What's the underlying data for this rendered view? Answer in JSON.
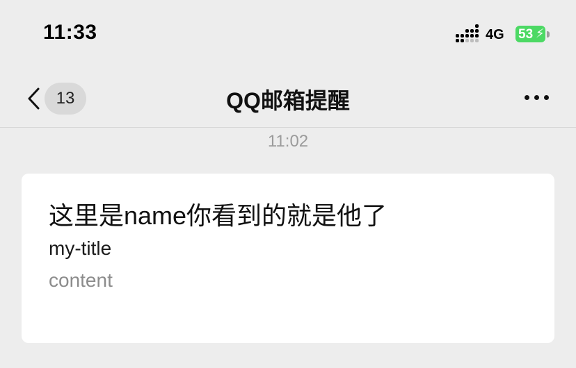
{
  "status_bar": {
    "time": "11:33",
    "network": "4G",
    "battery": "53"
  },
  "nav": {
    "unread_count": "13",
    "title": "QQ邮箱提醒"
  },
  "icons": {
    "back": "chevron-left-icon",
    "more": "more-horizontal-icon",
    "signal": "signal-icon",
    "battery": "battery-charging-icon"
  },
  "chat": {
    "timestamp": "11:02",
    "message_card": {
      "name": "这里是name你看到的就是他了",
      "title": "my-title",
      "content": "content"
    }
  },
  "colors": {
    "background": "#ededed",
    "card": "#ffffff",
    "battery": "#4cd964"
  }
}
